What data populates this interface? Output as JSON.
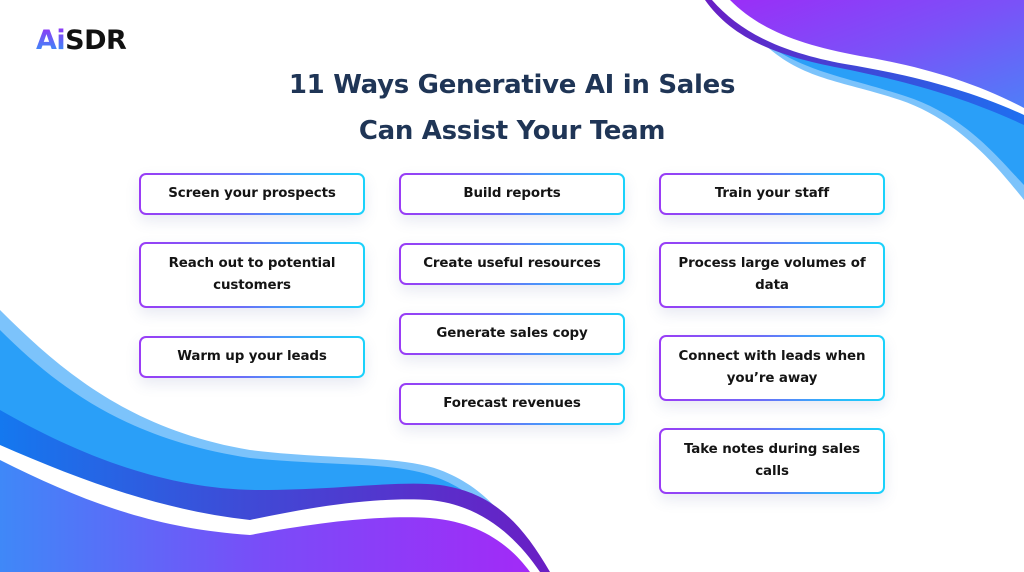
{
  "logo": {
    "part1": "Ai",
    "part2": "SDR"
  },
  "title": {
    "line1": "11 Ways Generative AI in Sales",
    "line2": "Can Assist Your Team"
  },
  "columns": [
    {
      "items": [
        {
          "label": "Screen your prospects"
        },
        {
          "label": "Reach out to potential customers"
        },
        {
          "label": "Warm up your leads"
        }
      ]
    },
    {
      "items": [
        {
          "label": "Build reports"
        },
        {
          "label": "Create useful resources"
        },
        {
          "label": "Generate sales copy"
        },
        {
          "label": "Forecast revenues"
        }
      ]
    },
    {
      "items": [
        {
          "label": "Train your staff"
        },
        {
          "label": "Process large volumes of data"
        },
        {
          "label": "Connect with leads when you’re away"
        },
        {
          "label": "Take notes during sales calls"
        }
      ]
    }
  ],
  "colors": {
    "title": "#1f3556",
    "card_border_start": "#9a3cf6",
    "card_border_end": "#1ad2fb",
    "wave_purple": "#8b35f7",
    "wave_blue": "#2a9ff8",
    "wave_light_blue": "#7cc3fb"
  }
}
